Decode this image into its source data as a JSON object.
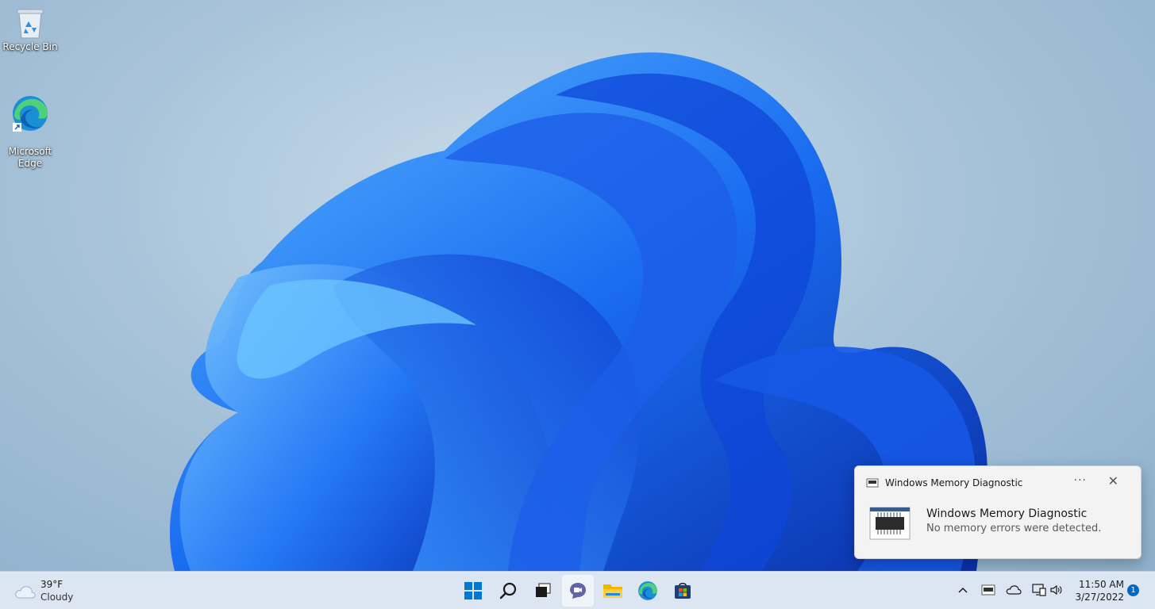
{
  "desktop": {
    "icons": [
      {
        "label": "Recycle Bin",
        "icon": "recycle-bin-icon"
      },
      {
        "label": "Microsoft\nEdge",
        "icon": "edge-icon"
      }
    ]
  },
  "toast": {
    "app_name": "Windows Memory Diagnostic",
    "more_label": "···",
    "close_label": "✕",
    "title": "Windows Memory Diagnostic",
    "message": "No memory errors were detected."
  },
  "taskbar": {
    "weather": {
      "temp": "39°F",
      "condition": "Cloudy",
      "icon": "cloud-icon"
    },
    "apps": [
      {
        "name": "start",
        "icon": "windows-start-icon"
      },
      {
        "name": "search",
        "icon": "search-icon"
      },
      {
        "name": "task-view",
        "icon": "task-view-icon"
      },
      {
        "name": "chat",
        "icon": "teams-chat-icon"
      },
      {
        "name": "file-explorer",
        "icon": "folder-icon"
      },
      {
        "name": "edge",
        "icon": "edge-icon"
      },
      {
        "name": "store",
        "icon": "store-icon"
      }
    ],
    "tray": {
      "overflow": "^",
      "time": "11:50 AM",
      "date": "3/27/2022",
      "notification_count": "1"
    }
  },
  "colors": {
    "accent": "#0067c0",
    "taskbar_bg": "#dce6f2",
    "bloom_dark": "#0a3fcf",
    "bloom_light": "#3fa0ff"
  }
}
